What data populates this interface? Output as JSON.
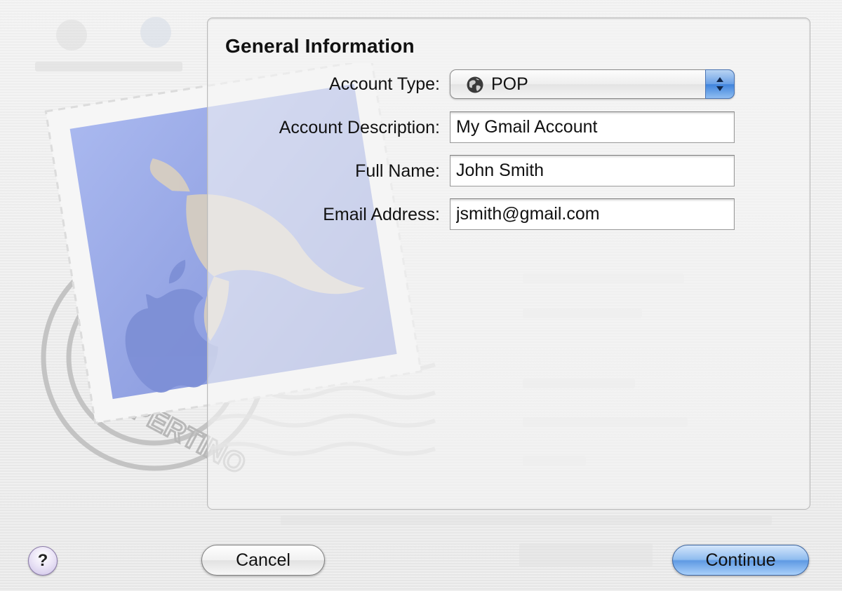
{
  "dialog": {
    "section_title": "General Information",
    "fields": {
      "account_type": {
        "label": "Account Type:",
        "selected": "POP",
        "icon": "globe-icon"
      },
      "account_description": {
        "label": "Account Description:",
        "value": "My Gmail Account"
      },
      "full_name": {
        "label": "Full Name:",
        "value": "John Smith"
      },
      "email_address": {
        "label": "Email Address:",
        "value": "jsmith@gmail.com"
      }
    }
  },
  "buttons": {
    "help": "?",
    "cancel": "Cancel",
    "continue": "Continue"
  },
  "colors": {
    "accent_blue": "#5f9ae3",
    "panel_border": "#b9b9b9",
    "stamp_blue": "#8e9fe2"
  }
}
